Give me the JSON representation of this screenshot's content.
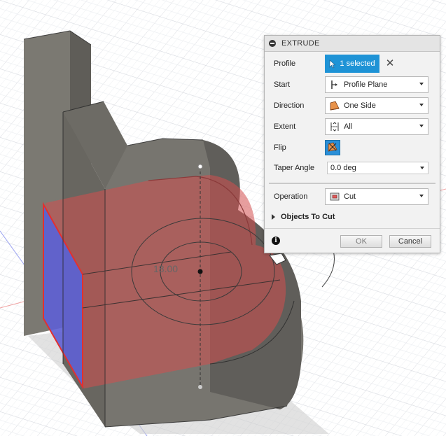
{
  "dialog": {
    "title": "EXTRUDE",
    "profile": {
      "label": "Profile",
      "value": "1 selected"
    },
    "start": {
      "label": "Start",
      "value": "Profile Plane"
    },
    "direction": {
      "label": "Direction",
      "value": "One Side"
    },
    "extent": {
      "label": "Extent",
      "value": "All"
    },
    "flip": {
      "label": "Flip"
    },
    "taper": {
      "label": "Taper Angle",
      "value": "0.0 deg"
    },
    "operation": {
      "label": "Operation",
      "value": "Cut"
    },
    "objects_to_cut": "Objects To Cut",
    "ok": "OK",
    "cancel": "Cancel"
  },
  "viewport": {
    "dimension_label": "18.00"
  },
  "colors": {
    "accent": "#1e93d6",
    "cut_preview": "#d63c3c",
    "selected_face": "#4a5fe0",
    "body": "#6f6d67"
  },
  "icons": [
    "collapse-icon",
    "cursor-icon",
    "close-icon",
    "profile-plane-icon",
    "one-side-icon",
    "extent-all-icon",
    "flip-icon",
    "cut-icon",
    "expand-triangle-icon",
    "info-icon"
  ]
}
